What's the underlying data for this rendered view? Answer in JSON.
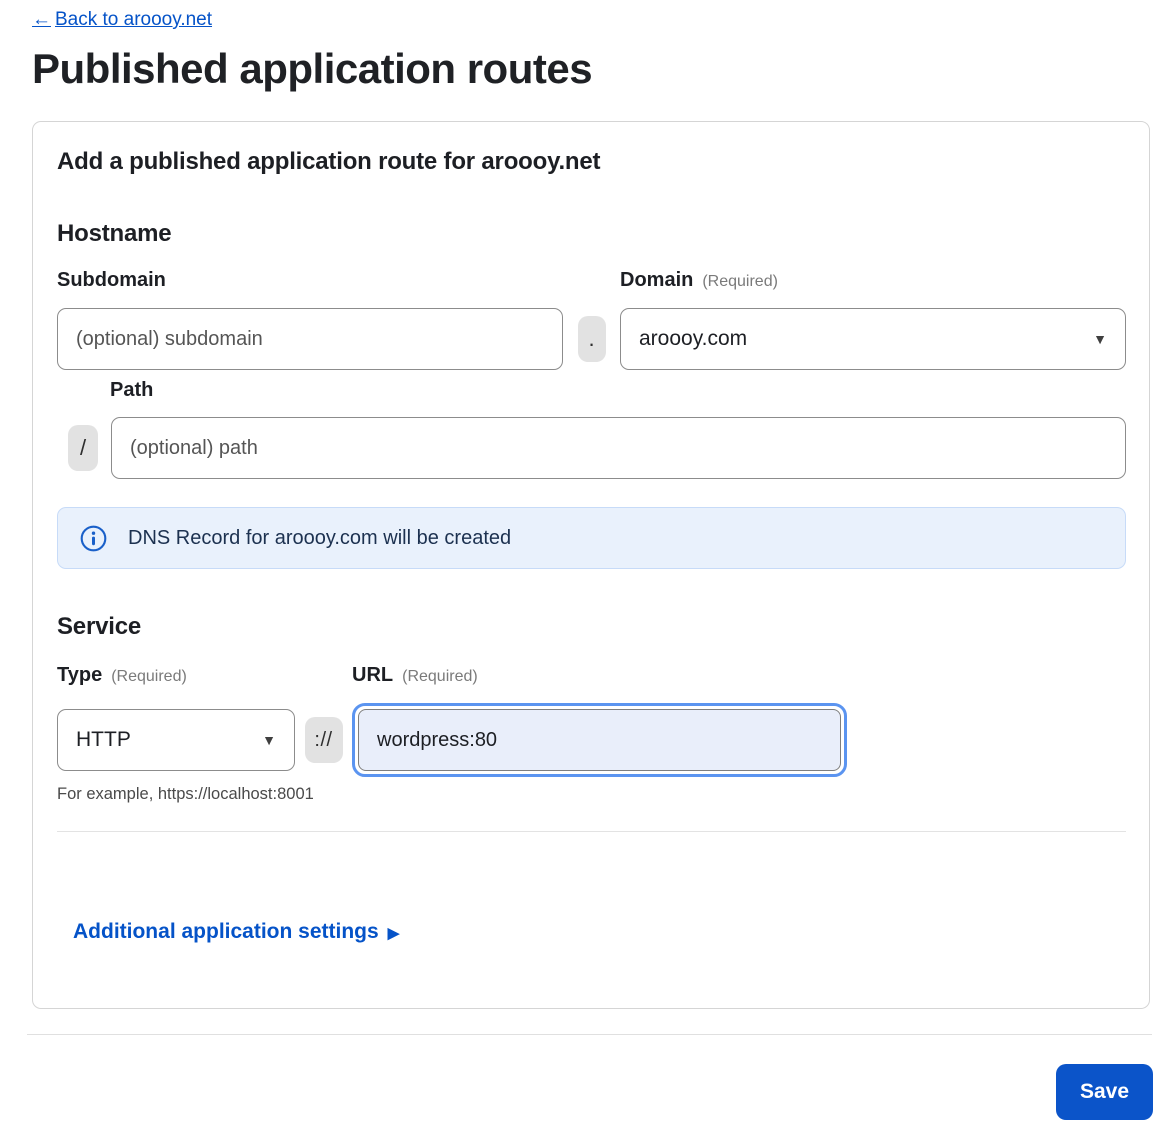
{
  "page": {
    "back_label": "Back to aroooy.net",
    "title": "Published application routes"
  },
  "icons": {
    "back_arrow": "←",
    "caret_down": "▼",
    "forward_arrow": "▶"
  },
  "card": {
    "title": "Add a published application route for aroooy.net",
    "hostname": {
      "heading": "Hostname",
      "subdomain_label": "Subdomain",
      "subdomain_placeholder": "(optional) subdomain",
      "dot_separator": ".",
      "domain_label": "Domain",
      "domain_required": "(Required)",
      "domain_value": "aroooy.com",
      "path_label": "Path",
      "path_separator": "/",
      "path_placeholder": "(optional) path"
    },
    "dns_notice": "DNS Record for aroooy.com will be created",
    "service": {
      "heading": "Service",
      "type_label": "Type",
      "type_required": "(Required)",
      "type_value": "HTTP",
      "scheme_separator": "://",
      "url_label": "URL",
      "url_required": "(Required)",
      "url_value": "wordpress:80",
      "url_example": "For example, https://localhost:8001"
    },
    "additional_settings_label": "Additional application settings"
  },
  "footer": {
    "save_label": "Save"
  },
  "colors": {
    "accent_blue": "#0553c8",
    "button_blue": "#0b54c9",
    "banner_bg": "#e9f1fc",
    "focus_ring": "#5b94f0"
  }
}
